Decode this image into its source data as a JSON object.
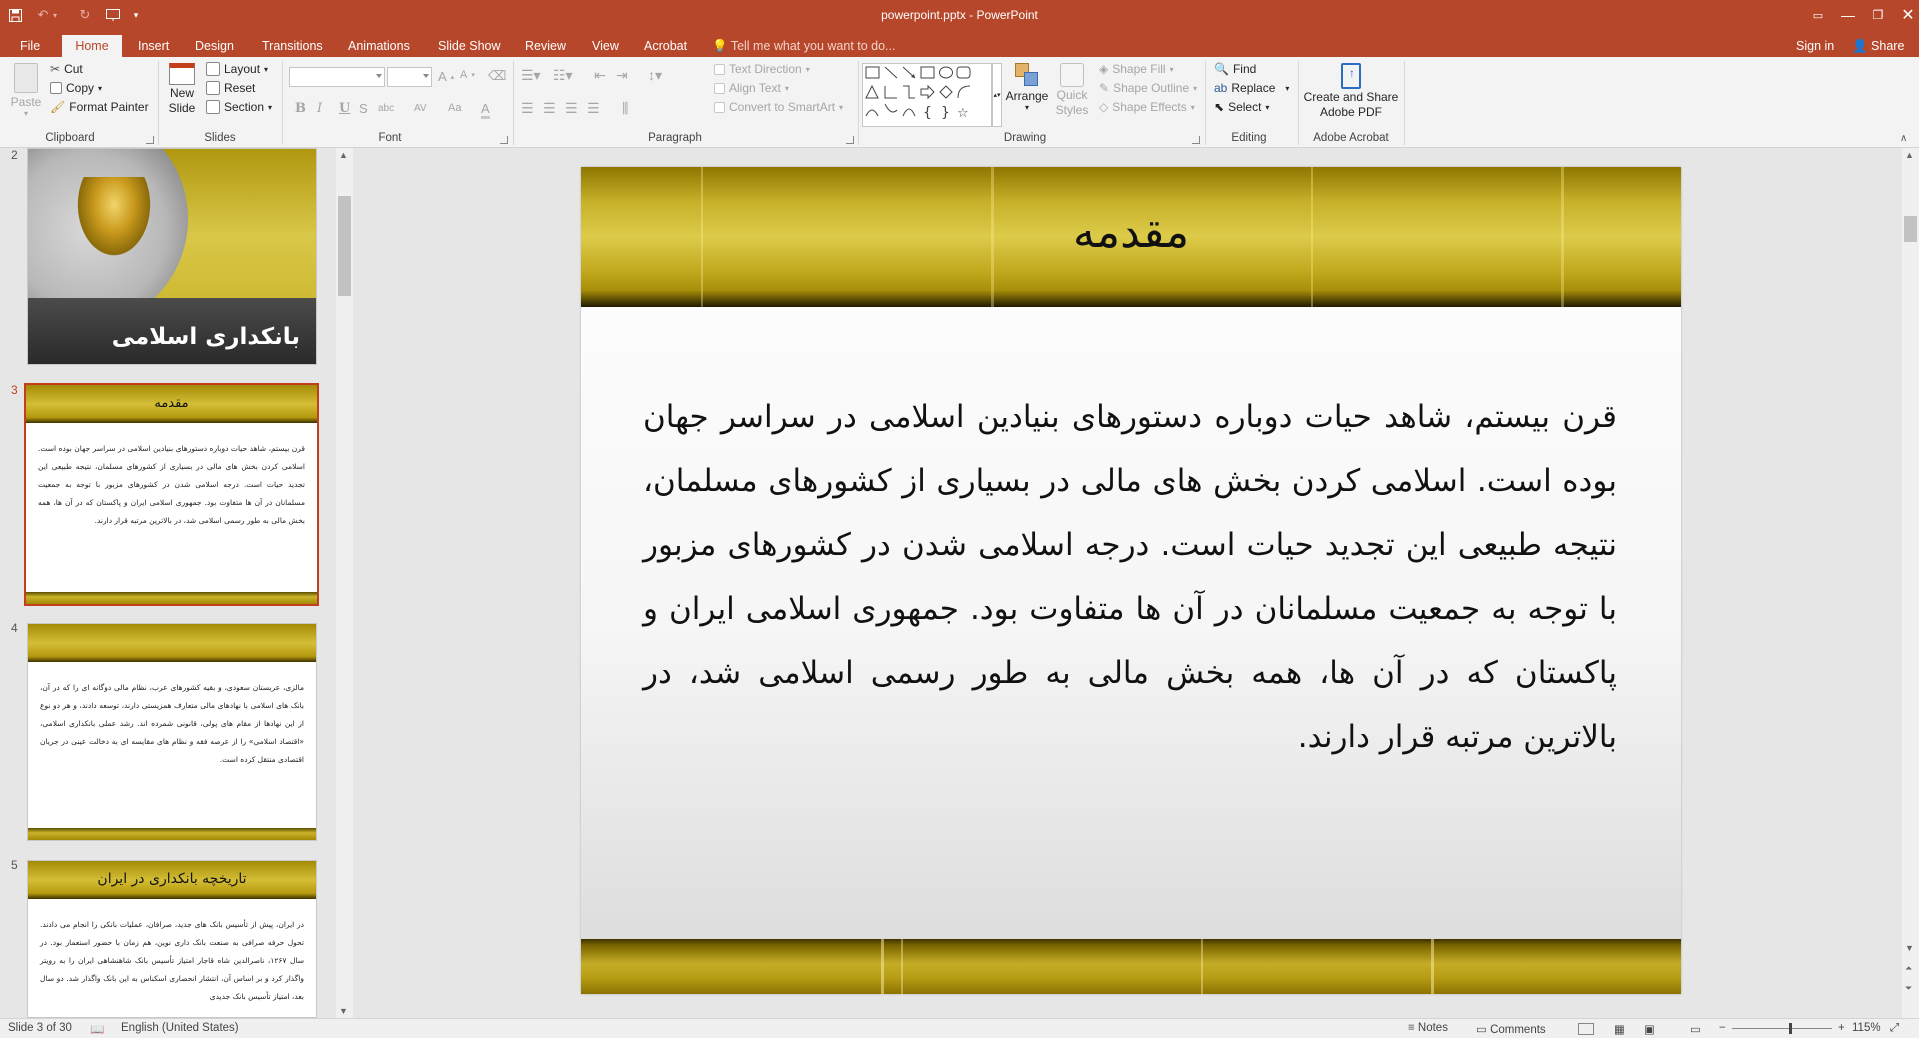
{
  "window": {
    "title": "powerpoint.pptx - PowerPoint",
    "minimize_icon": "minimize-icon",
    "restore_icon": "restore-icon",
    "close_icon": "close-icon"
  },
  "quick_access": {
    "save_icon": "save-icon",
    "undo_icon": "undo-icon",
    "redo_icon": "redo-icon",
    "start_icon": "slideshow-start-icon"
  },
  "tabs": [
    "File",
    "Home",
    "Insert",
    "Design",
    "Transitions",
    "Animations",
    "Slide Show",
    "Review",
    "View",
    "Acrobat"
  ],
  "active_tab": "Home",
  "tell_me": "Tell me what you want to do...",
  "sign_in": "Sign in",
  "share": "Share",
  "ribbon": {
    "clipboard": {
      "label": "Clipboard",
      "paste": "Paste",
      "cut": "Cut",
      "copy": "Copy",
      "format_painter": "Format Painter"
    },
    "slides": {
      "label": "Slides",
      "new_slide_1": "New",
      "new_slide_2": "Slide",
      "layout": "Layout",
      "reset": "Reset",
      "section": "Section"
    },
    "font": {
      "label": "Font",
      "bold": "B",
      "italic": "I",
      "underline": "U",
      "strike": "S",
      "shadow": "abc",
      "spacing": "AV",
      "case": "Aa",
      "color": "A"
    },
    "paragraph": {
      "label": "Paragraph",
      "text_direction": "Text Direction",
      "align_text": "Align Text",
      "smartart": "Convert to SmartArt"
    },
    "drawing": {
      "label": "Drawing",
      "arrange": "Arrange",
      "quick_styles_1": "Quick",
      "quick_styles_2": "Styles",
      "shape_fill": "Shape Fill",
      "shape_outline": "Shape Outline",
      "shape_effects": "Shape Effects"
    },
    "editing": {
      "label": "Editing",
      "find": "Find",
      "replace": "Replace",
      "select": "Select"
    },
    "acrobat": {
      "label": "Adobe Acrobat",
      "create_1": "Create and Share",
      "create_2": "Adobe PDF"
    }
  },
  "thumbnails": [
    {
      "number": "2",
      "title": "بانکداری اسلامی"
    },
    {
      "number": "3",
      "title": "مقدمه",
      "body": "قرن بیستم، شاهد حیات دوباره دستورهای بنیادین اسلامی در سراسر جهان بوده است. اسلامی کردن بخش های مالی در بسیاری از کشورهای مسلمان، نتیجه طبیعی این تجدید حیات است. درجه اسلامی شدن در کشورهای مزبور با توجه به جمعیت مسلمانان در آن ها متفاوت بود. جمهوری اسلامی ایران و پاکستان که در آن ها، همه بخش مالی به طور رسمی اسلامی شد، در بالاترین مرتبه قرار دارند."
    },
    {
      "number": "4",
      "title": "",
      "body": "مالزی، عربستان سعودی، و بقیه کشورهای عرب، نظام مالی دوگانه ای را که در آن، بانک های اسلامی با نهادهای مالی متعارف همزیستی دارند، توسعه دادند، و هر دو نوع از این نهادها از مقام های پولی، قانونی شمرده اند. رشد عملی بانکداری اسلامی، «اقتصاد اسلامی» را از عرصه فقه و نظام های مقایسه ای به دخالت عینی در جریان اقتصادی منتقل کرده است."
    },
    {
      "number": "5",
      "title": "تاریخچه بانکداری در ایران",
      "body": "در ایران، پیش از تأسیس بانک های جدید، صرافان، عملیات بانکی را انجام می دادند. تحول حرفه صرافی به صنعت بانک داری نوین، هم زمان با حضور استعمار بود. در سال ۱۲۶۷، ناصرالدین شاه قاجار امتیاز تأسیس بانک شاهنشاهی ایران را به رویتر واگذار کرد و بر اساس آن، انتشار انحصاری اسکناس به این بانک واگذار شد. دو سال بعد، امتیاز تأسیس بانک جدیدی"
    }
  ],
  "slide": {
    "title": "مقدمه",
    "body": "قرن بیستم، شاهد حیات دوباره دستورهای بنیادین اسلامی در سراسر جهان بوده است. اسلامی کردن بخش های مالی در بسیاری از کشورهای مسلمان، نتیجه طبیعی این تجدید حیات است. درجه اسلامی شدن در کشورهای مزبور با توجه به جمعیت مسلمانان در آن ها متفاوت بود. جمهوری اسلامی ایران و پاکستان که در آن ها، همه بخش مالی به طور رسمی اسلامی شد، در بالاترین مرتبه قرار دارند."
  },
  "status": {
    "slide_indicator": "Slide 3 of 30",
    "language": "English (United States)",
    "notes": "Notes",
    "comments": "Comments",
    "zoom": "115%",
    "zoom_level": 0.58
  },
  "colors": {
    "accent": "#b7472a",
    "slide_gold": "#c8b12a",
    "selection": "#c43e1c"
  }
}
